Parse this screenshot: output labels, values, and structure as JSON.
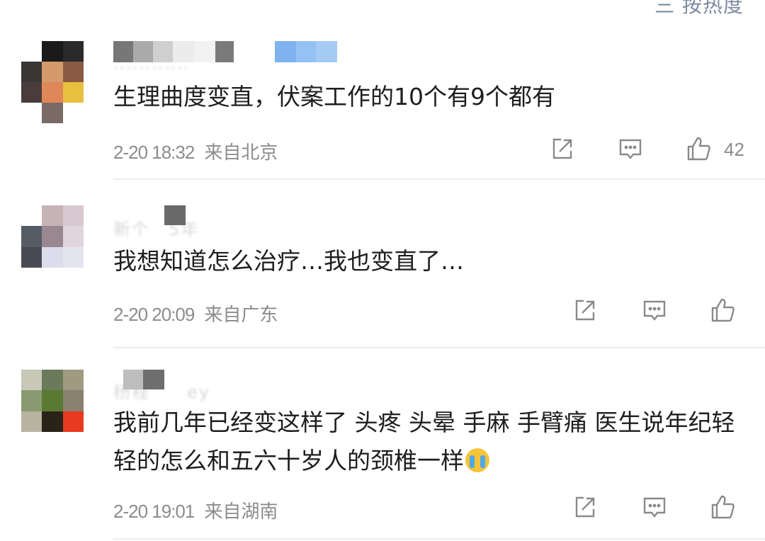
{
  "header": {
    "sort_label": "三 按热度"
  },
  "comments": [
    {
      "text": "生理曲度变直，伏案工作的10个有9个都有",
      "time": "2-20 18:32",
      "location": "来自北京",
      "likes": "42"
    },
    {
      "text": "我想知道怎么治疗…我也变直了…",
      "time": "2-20 20:09",
      "location": "来自广东",
      "likes": ""
    },
    {
      "text": "我前几年已经变这样了 头疼 头晕 手麻 手臂痛 医生说年纪轻轻的怎么和五六十岁人的颈椎一样",
      "emoji": "crying-emoji",
      "time": "2-20 19:01",
      "location": "来自湖南",
      "likes": ""
    }
  ],
  "icons": {
    "repost": "share-icon",
    "reply": "comment-icon",
    "like": "thumbs-up-icon"
  },
  "colors": {
    "text": "#1e1e1e",
    "meta": "#8c8c8c",
    "icon": "#8a8a8a",
    "sort": "#7c8aa0"
  }
}
